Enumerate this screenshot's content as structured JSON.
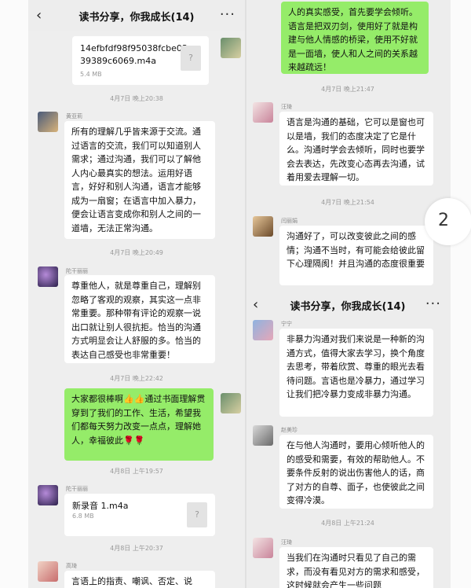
{
  "left_panel": {
    "header": {
      "back": "‹",
      "title": "读书分享，你我成长(14)",
      "more": "···"
    },
    "file1": {
      "name": "14efbfdf98f95038fcbe0339389c6069.m4a",
      "size": "5.4 MB",
      "icon": "?"
    },
    "ts1": "4月7日 晚上20:38",
    "msg1": {
      "sender": "黄亚莉",
      "text": "所有的理解几乎皆来源于交流。通过语言的交流，我们可以知道别人需求；通过沟通，我们可以了解他人内心最真实的想法。运用好语言，好好和别人沟通，语言才能够成为一扇窗；在语言中加入暴力，便会让语言变成你和别人之间的一道墙，无法正常沟通。"
    },
    "ts2": "4月7日 晚上20:49",
    "msg2": {
      "sender": "陀干丽丽",
      "text": "尊重他人，就是尊重自己，理解别忽略了客观的观察，其实这一点非常重要。那种带有评论的观察一说出口就让别人很抗拒。恰当的沟通方式明显会让人舒服的多。恰当的表达自己感受也非常重要！"
    },
    "ts3": "4月7日 晚上22:42",
    "msg3": {
      "text": "大家都很棒啊👍👍通过书面理解贯穿到了我们的工作、生活，希望我们都每天努力改变一点点，理解她人，幸福彼此🌹🌹"
    },
    "ts4": "4月8日 上午19:57",
    "msg4": {
      "sender": "陀干丽丽",
      "file_name": "新录音 1.m4a",
      "file_size": "6.8 MB",
      "icon": "?"
    },
    "ts5": "4月8日 上午20:37",
    "msg5": {
      "sender": "高琦",
      "text": "言语上的指责、嘲讽、否定、说"
    }
  },
  "right_panel": {
    "msg0": {
      "text": "人的真实感受，首先要学会倾听。语言是把双刃剑，使用好了就是构建与他人情感的桥梁，使用不好就是一面墙，使人和人之间的关系越来越疏远！"
    },
    "ts1": "4月7日 晚上21:47",
    "msg1": {
      "sender": "汪琦",
      "text": "语言是沟通的基础，它可以是窗也可以是墙，我们的态度决定了它是什么。沟通时学会去倾听，同时也要学会去表达，先改变心态再去沟通，试着用爱去理解一切。"
    },
    "ts2": "4月7日 晚上21:54",
    "msg2": {
      "sender": "闫丽娟",
      "text": "沟通好了，可以改变彼此之间的感情；沟通不当时，有可能会给彼此留下心理隔阂！并且沟通的态度很重要"
    },
    "header": {
      "back": "‹",
      "title": "读书分享，你我成长(14)",
      "more": "···"
    },
    "msg3": {
      "sender": "宁宁",
      "text": "非暴力沟通对我们来说是一种新的沟通方式，值得大家去学习，换个角度去思考，带着欣赏、尊重的眼光去看待问题。言语也是冷暴力，通过学习让我们把冷暴力变成非暴力沟通。"
    },
    "msg4": {
      "sender": "赵美珍",
      "text": "在与他人沟通时，要用心倾听他人的的感受和需要，有效的帮助他人。不要条件反射的说出伤害他人的话，商了对方的自尊、面子，也使彼此之间变得冷漠。"
    },
    "ts3": "4月8日 上午21:24",
    "msg5": {
      "sender": "汪琦",
      "text": "当我们在沟通时只看见了自己的需求，而没有看见对方的需求和感受，这时候就会产生一些问题"
    }
  },
  "page_badge": "2"
}
